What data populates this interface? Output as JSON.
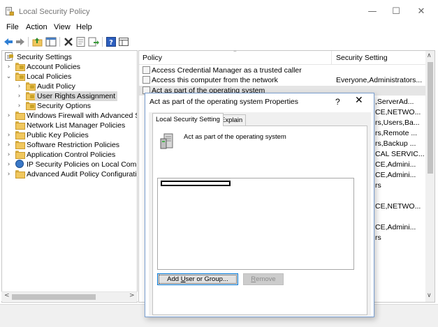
{
  "window": {
    "title": "Local Security Policy",
    "controls": {
      "minimize": "—",
      "maximize": "☐",
      "close": "✕"
    }
  },
  "menu": [
    "File",
    "Action",
    "View",
    "Help"
  ],
  "toolbar_icons": [
    "back-arrow-icon",
    "forward-arrow-icon",
    "up-folder-icon",
    "show-hide-tree-icon",
    "delete-icon",
    "properties-icon",
    "export-list-icon",
    "help-icon",
    "console-view-icon"
  ],
  "tree": {
    "root": "Security Settings",
    "account_policies": "Account Policies",
    "local_policies": "Local Policies",
    "audit_policy": "Audit Policy",
    "user_rights_assignment": "User Rights Assignment",
    "security_options": "Security Options",
    "windows_firewall": "Windows Firewall with Advanced Secu",
    "network_list": "Network List Manager Policies",
    "public_key": "Public Key Policies",
    "software_restriction": "Software Restriction Policies",
    "application_control": "Application Control Policies",
    "ip_security": "IP Security Policies on Local Compute",
    "advanced_audit": "Advanced Audit Policy Configuration"
  },
  "list": {
    "columns": {
      "policy": "Policy",
      "setting": "Security Setting"
    },
    "rows": [
      {
        "policy": "Access Credential Manager as a trusted caller",
        "setting": ""
      },
      {
        "policy": "Access this computer from the network",
        "setting": "Everyone,Administrators..."
      },
      {
        "policy": "Act as part of the operating system",
        "setting": ""
      }
    ],
    "overflow_settings": [
      ",ServerAd...",
      "CE,NETWO...",
      "rs,Users,Ba...",
      "rs,Remote ...",
      "rs,Backup ...",
      "CAL SERVIC...",
      "CE,Admini...",
      "CE,Admini...",
      "rs",
      "CE,NETWO...",
      "CE,Admini...",
      "rs"
    ]
  },
  "dialog": {
    "title": "Act as part of the operating system Properties",
    "help": "?",
    "close": "✕",
    "tabs": [
      "Local Security Setting",
      "Explain"
    ],
    "policy_name": "Act as part of the operating system",
    "buttons": {
      "add_pre": "Add ",
      "add_u": "U",
      "add_post": "ser or Group...",
      "remove_u": "R",
      "remove_post": "emove"
    }
  },
  "colors": {
    "accent_border": "#0078d7",
    "selection": "#e5e5e5",
    "folder": "#f0c75e"
  }
}
